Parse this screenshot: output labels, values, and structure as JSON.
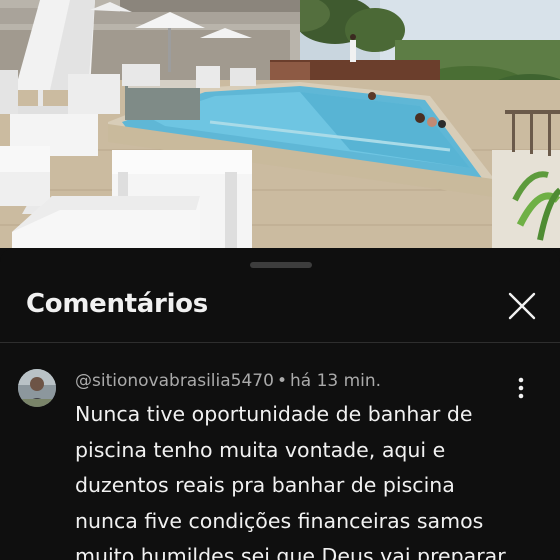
{
  "video": {
    "description_icon": "resort-pool-scene"
  },
  "comments_panel": {
    "title": "Comentários",
    "close_icon": "close-icon"
  },
  "comment": {
    "author": "@sitionovabrasilia5470",
    "separator": "•",
    "time_ago": "há 13 min.",
    "text": "Nunca tive oportunidade de banhar de piscina tenho muita vontade, aqui e duzentos reais pra banhar de piscina nunca five condições financeiras samos muito humildes sei que Deus vai preparar",
    "more_icon": "more-vertical-icon"
  },
  "colors": {
    "background": "#0f0f0f",
    "text_primary": "#f1f1f1",
    "text_secondary": "#aaaaaa",
    "divider": "#2e2e2e"
  }
}
